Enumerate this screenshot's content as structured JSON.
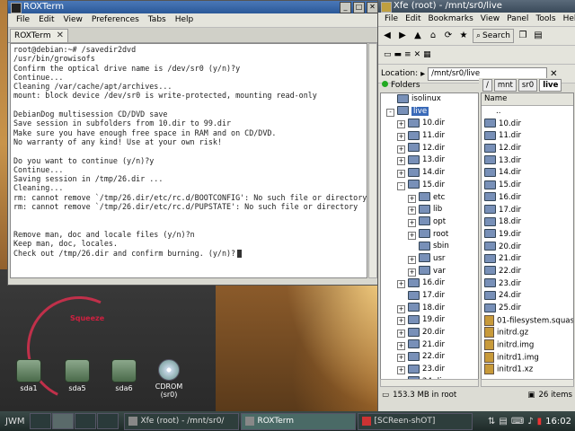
{
  "desktop": {
    "squeeze_label": "Squeeze",
    "icons": [
      {
        "label": "sda1",
        "type": "drive"
      },
      {
        "label": "sda5",
        "type": "drive"
      },
      {
        "label": "sda6",
        "type": "drive"
      },
      {
        "label": "CDROM\n(sr0)",
        "type": "cdrom"
      }
    ]
  },
  "roxterm": {
    "title": "ROXTerm",
    "menu": [
      "File",
      "Edit",
      "View",
      "Preferences",
      "Tabs",
      "Help"
    ],
    "tab_label": "ROXTerm",
    "lines": [
      "root@debian:~# /savedir2dvd",
      "/usr/bin/growisofs",
      "Confirm the optical drive name is /dev/sr0 (y/n)?y",
      "Continue...",
      "Cleaning /var/cache/apt/archives...",
      "mount: block device /dev/sr0 is write-protected, mounting read-only",
      "",
      "DebianDog multisession CD/DVD save",
      "Save session in subfolders from 10.dir to 99.dir",
      "Make sure you have enough free space in RAM and on CD/DVD.",
      "No warranty of any kind! Use at your own risk!",
      "",
      "Do you want to continue (y/n)?y",
      "Continue...",
      "Saving session in /tmp/26.dir ...",
      "Cleaning...",
      "rm: cannot remove `/tmp/26.dir/etc/rc.d/BOOTCONFIG': No such file or directory",
      "rm: cannot remove `/tmp/26.dir/etc/rc.d/PUPSTATE': No such file or directory",
      "",
      "",
      "Remove man, doc and locale files (y/n)?n",
      "Keep man, doc, locales.",
      "Check out /tmp/26.dir and confirm burning. (y/n)?"
    ]
  },
  "xfe": {
    "title": "Xfe (root) - /mnt/sr0/live",
    "menu": [
      "File",
      "Edit",
      "Bookmarks",
      "View",
      "Panel",
      "Tools",
      "Help"
    ],
    "search_label": "Search",
    "location_label": "Location:",
    "location_value": "/mnt/sr0/live",
    "breadcrumbs": [
      "/",
      "mnt",
      "sr0",
      "live"
    ],
    "folders_header": "Folders",
    "name_header": "Name",
    "tree": [
      {
        "label": "isolinux",
        "indent": 1,
        "pm": ""
      },
      {
        "label": "live",
        "indent": 1,
        "pm": "-",
        "selected": true
      },
      {
        "label": "10.dir",
        "indent": 2,
        "pm": "+"
      },
      {
        "label": "11.dir",
        "indent": 2,
        "pm": "+"
      },
      {
        "label": "12.dir",
        "indent": 2,
        "pm": "+"
      },
      {
        "label": "13.dir",
        "indent": 2,
        "pm": "+"
      },
      {
        "label": "14.dir",
        "indent": 2,
        "pm": "+"
      },
      {
        "label": "15.dir",
        "indent": 2,
        "pm": "-"
      },
      {
        "label": "etc",
        "indent": 3,
        "pm": "+"
      },
      {
        "label": "lib",
        "indent": 3,
        "pm": "+"
      },
      {
        "label": "opt",
        "indent": 3,
        "pm": "+"
      },
      {
        "label": "root",
        "indent": 3,
        "pm": "+"
      },
      {
        "label": "sbin",
        "indent": 3,
        "pm": ""
      },
      {
        "label": "usr",
        "indent": 3,
        "pm": "+"
      },
      {
        "label": "var",
        "indent": 3,
        "pm": "+"
      },
      {
        "label": "16.dir",
        "indent": 2,
        "pm": "+"
      },
      {
        "label": "17.dir",
        "indent": 2,
        "pm": ""
      },
      {
        "label": "18.dir",
        "indent": 2,
        "pm": "+"
      },
      {
        "label": "19.dir",
        "indent": 2,
        "pm": "+"
      },
      {
        "label": "20.dir",
        "indent": 2,
        "pm": "+"
      },
      {
        "label": "21.dir",
        "indent": 2,
        "pm": "+"
      },
      {
        "label": "22.dir",
        "indent": 2,
        "pm": "+"
      },
      {
        "label": "23.dir",
        "indent": 2,
        "pm": "+"
      },
      {
        "label": "24.dir",
        "indent": 2,
        "pm": "+"
      }
    ],
    "files": [
      {
        "name": "..",
        "kind": "up"
      },
      {
        "name": "10.dir",
        "kind": "dir"
      },
      {
        "name": "11.dir",
        "kind": "dir"
      },
      {
        "name": "12.dir",
        "kind": "dir"
      },
      {
        "name": "13.dir",
        "kind": "dir"
      },
      {
        "name": "14.dir",
        "kind": "dir"
      },
      {
        "name": "15.dir",
        "kind": "dir"
      },
      {
        "name": "16.dir",
        "kind": "dir"
      },
      {
        "name": "17.dir",
        "kind": "dir"
      },
      {
        "name": "18.dir",
        "kind": "dir"
      },
      {
        "name": "19.dir",
        "kind": "dir"
      },
      {
        "name": "20.dir",
        "kind": "dir"
      },
      {
        "name": "21.dir",
        "kind": "dir"
      },
      {
        "name": "22.dir",
        "kind": "dir"
      },
      {
        "name": "23.dir",
        "kind": "dir"
      },
      {
        "name": "24.dir",
        "kind": "dir"
      },
      {
        "name": "25.dir",
        "kind": "dir"
      },
      {
        "name": "01-filesystem.squashfs",
        "kind": "file"
      },
      {
        "name": "initrd.gz",
        "kind": "file"
      },
      {
        "name": "initrd.img",
        "kind": "file"
      },
      {
        "name": "initrd1.img",
        "kind": "file"
      },
      {
        "name": "initrd1.xz",
        "kind": "file"
      }
    ],
    "status_free": "153.3 MB in root",
    "status_items": "26 items"
  },
  "taskbar": {
    "menu_label": "JWM",
    "tasks": [
      {
        "label": "Xfe (root) - /mnt/sr0/",
        "active": false
      },
      {
        "label": "ROXTerm",
        "active": true
      },
      {
        "label": "[SCReen-shOT]",
        "active": false
      }
    ],
    "clock": "16:02"
  }
}
